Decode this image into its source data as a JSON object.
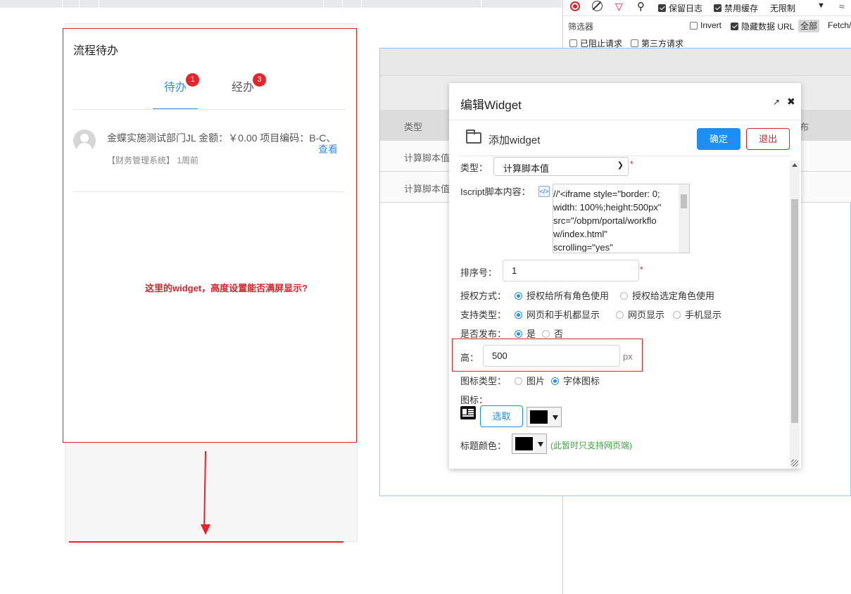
{
  "devtools": {
    "preserve_log": "保留日志",
    "disable_cache": "禁用缓存",
    "throttle": "无限制",
    "filter_label": "筛选器",
    "invert": "Invert",
    "hide_data_urls": "隐藏数据 URL",
    "all_chip": "全部",
    "fetch_chip": "Fetch/",
    "blocked_requests": "已阻止请求",
    "third_party": "第三方请求"
  },
  "widget": {
    "title": "流程待办",
    "tabs": [
      {
        "label": "待办",
        "badge": "1"
      },
      {
        "label": "经办",
        "badge": "3"
      }
    ],
    "item": {
      "text": "金蝶实施测试部门JL 金额：￥0.00 项目编码：B-C、",
      "link": "查看",
      "meta": "【财务管理系统】 1周前"
    }
  },
  "annotation": "这里的widget，高度设置能否满屏显示?",
  "bg_table": {
    "header_type": "类型",
    "header_partial": "布",
    "rows": [
      "计算脚本值",
      "计算脚本值"
    ]
  },
  "modal": {
    "title": "编辑Widget",
    "subtitle": "添加widget",
    "ok": "确定",
    "exit": "退出",
    "form": {
      "type_label": "类型：",
      "type_value": "计算脚本值",
      "required_mark": "*",
      "script_label": "Iscript脚本内容：",
      "script_value": "//'<iframe style=\"border: 0;\nwidth: 100%;height:500px\"\nsrc=\"/obpm/portal/workflo\nw/index.html\"\nscrolling=\"yes\"",
      "order_label": "排序号：",
      "order_value": "1",
      "auth_label": "授权方式：",
      "auth_options": [
        "授权给所有角色使用",
        "授权给选定角色使用"
      ],
      "support_label": "支持类型：",
      "support_options": [
        "网页和手机都显示",
        "网页显示",
        "手机显示"
      ],
      "publish_label": "是否发布：",
      "publish_options": [
        "是",
        "否"
      ],
      "height_label": "高：",
      "height_value": "500",
      "height_unit": "px",
      "icon_type_label": "图标类型：",
      "icon_type_options": [
        "图片",
        "字体图标"
      ],
      "icon_label": "图标：",
      "pick_button": "选取",
      "title_color_label": "标题颜色：",
      "title_color_note": "(此暂时只支持网页端)",
      "title_color_value": "#000000"
    }
  }
}
